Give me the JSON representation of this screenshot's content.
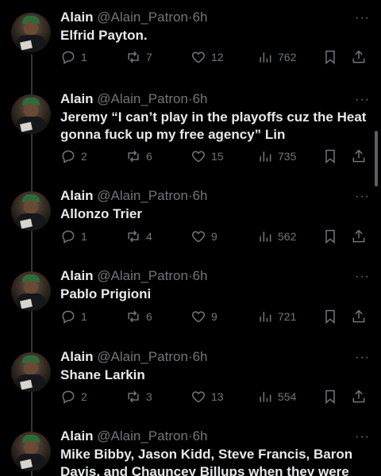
{
  "tweets": [
    {
      "name": "Alain",
      "handle": "@Alain_Patron",
      "time": "6h",
      "text": "Elfrid Payton.",
      "replies": "1",
      "retweets": "7",
      "likes": "12",
      "views": "762"
    },
    {
      "name": "Alain",
      "handle": "@Alain_Patron",
      "time": "6h",
      "text": "Jeremy “I can’t play in the playoffs cuz the Heat gonna fuck up my free agency” Lin",
      "replies": "2",
      "retweets": "6",
      "likes": "15",
      "views": "735"
    },
    {
      "name": "Alain",
      "handle": "@Alain_Patron",
      "time": "6h",
      "text": "Allonzo Trier",
      "replies": "1",
      "retweets": "4",
      "likes": "9",
      "views": "562"
    },
    {
      "name": "Alain",
      "handle": "@Alain_Patron",
      "time": "6h",
      "text": "Pablo Prigioni",
      "replies": "1",
      "retweets": "6",
      "likes": "9",
      "views": "721"
    },
    {
      "name": "Alain",
      "handle": "@Alain_Patron",
      "time": "6h",
      "text": "Shane Larkin",
      "replies": "2",
      "retweets": "3",
      "likes": "13",
      "views": "554"
    },
    {
      "name": "Alain",
      "handle": "@Alain_Patron",
      "time": "6h",
      "text": "Mike Bibby, Jason Kidd, Steve Francis, Baron Davis, and Chauncey Billups when they were",
      "replies": "",
      "retweets": "",
      "likes": "",
      "views": ""
    }
  ],
  "separator": "·",
  "more_glyph": "···"
}
